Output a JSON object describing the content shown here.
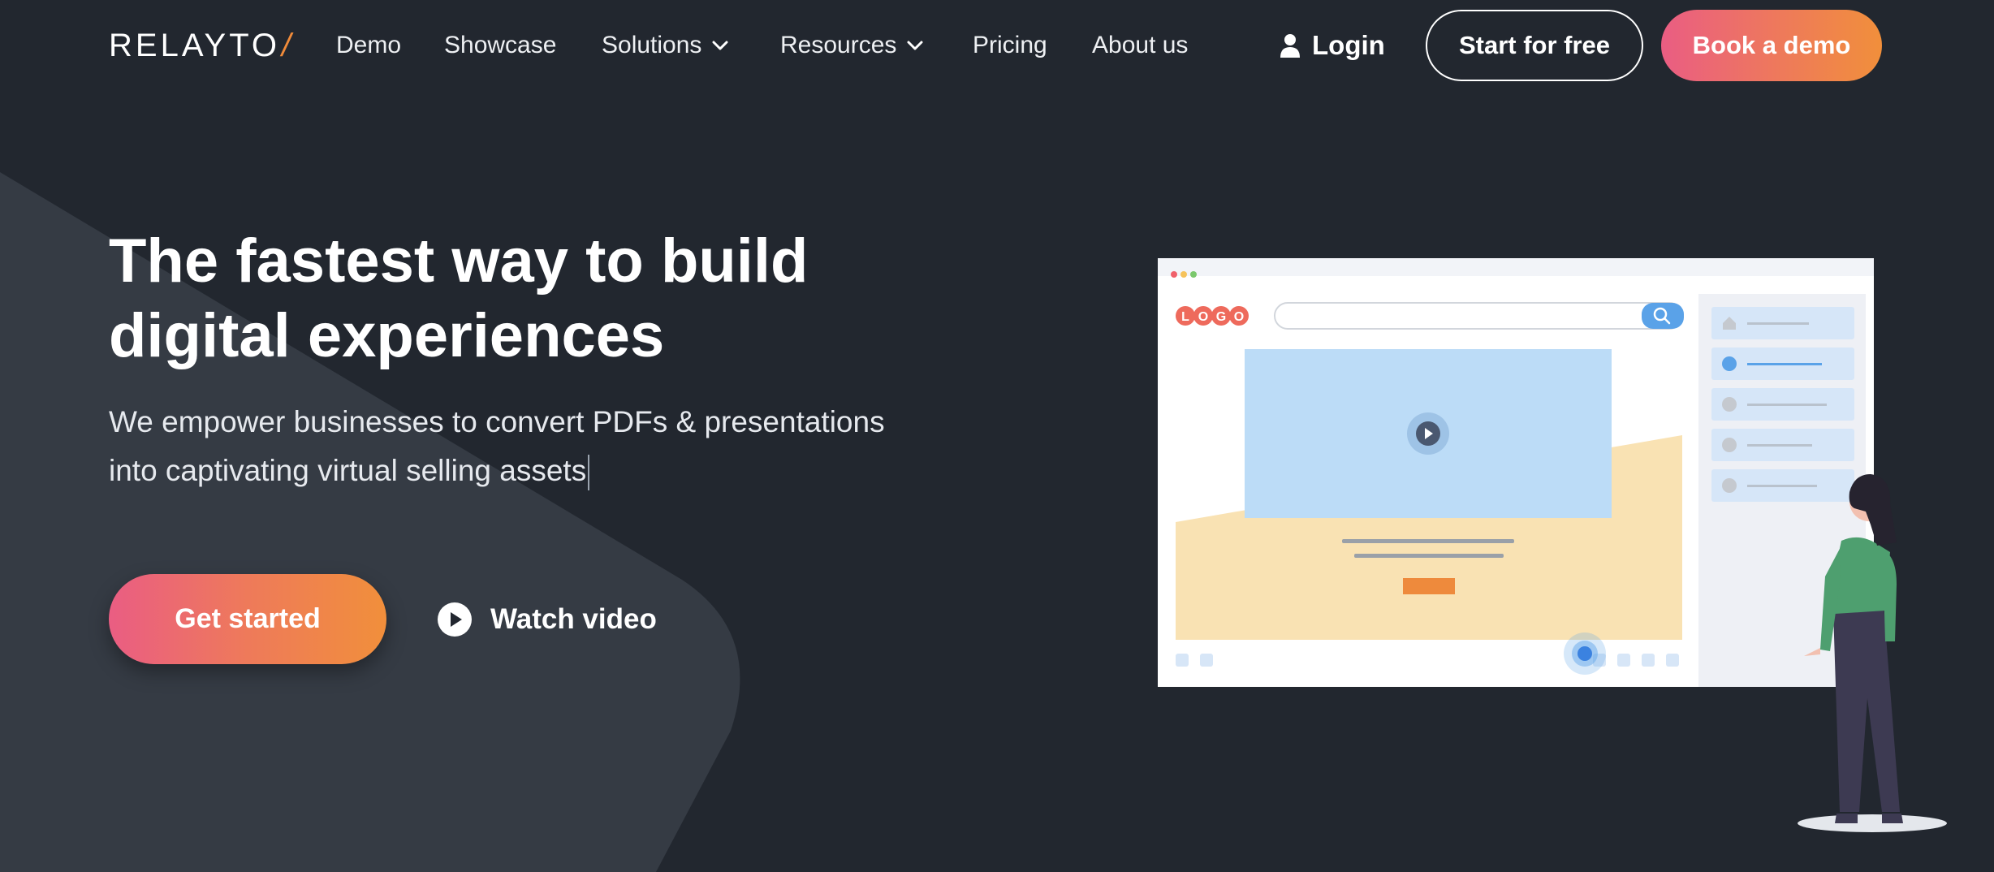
{
  "brand": {
    "name": "RELAYTO",
    "slash": "/"
  },
  "nav": {
    "links": [
      {
        "label": "Demo"
      },
      {
        "label": "Showcase"
      },
      {
        "label": "Solutions",
        "has_dropdown": true
      },
      {
        "label": "Resources",
        "has_dropdown": true
      },
      {
        "label": "Pricing"
      },
      {
        "label": "About us"
      }
    ],
    "login_label": "Login",
    "start_label": "Start for free",
    "demo_label": "Book a demo"
  },
  "hero": {
    "title_line1": "The fastest way to build",
    "title_line2": "digital experiences",
    "subtitle_line1": "We empower businesses to convert PDFs & presentations",
    "subtitle_line2": "into captivating virtual selling assets",
    "cta_label": "Get started",
    "video_label": "Watch video"
  },
  "illustration": {
    "logo_letters": [
      "L",
      "O",
      "G",
      "O"
    ],
    "icons": [
      "play-icon",
      "search-icon",
      "home-icon",
      "user-icon",
      "chevron-down-icon"
    ]
  },
  "colors": {
    "background": "#22272f",
    "accent_pink": "#ea5d83",
    "accent_orange": "#f18f3b",
    "browser_blue": "#5aa2e8",
    "video_blue": "#bcdcf7",
    "sand": "#f9e2b3",
    "figure_green": "#4e9f6f",
    "figure_dark": "#3d3a52"
  }
}
